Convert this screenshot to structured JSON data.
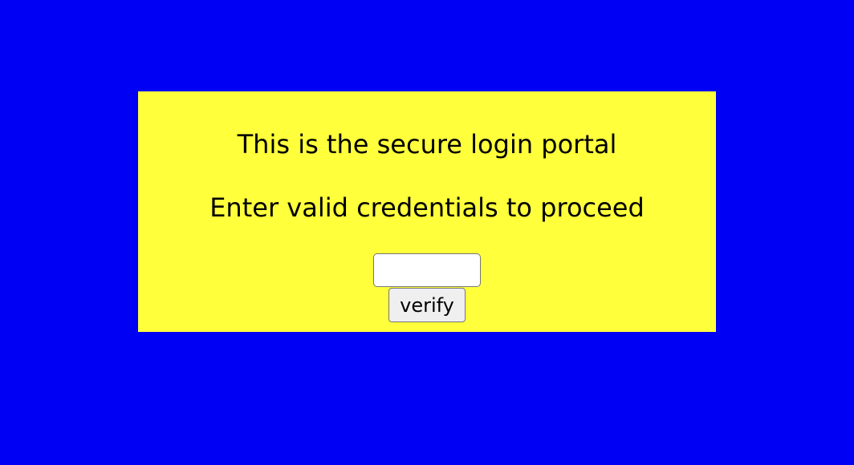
{
  "colors": {
    "page_background": "#0000f5",
    "panel_background": "#ffff3c",
    "text": "#000000"
  },
  "panel": {
    "title": "This is the secure login portal",
    "subtitle": "Enter valid credentials to proceed",
    "input": {
      "value": "",
      "placeholder": ""
    },
    "verify_label": "verify"
  }
}
